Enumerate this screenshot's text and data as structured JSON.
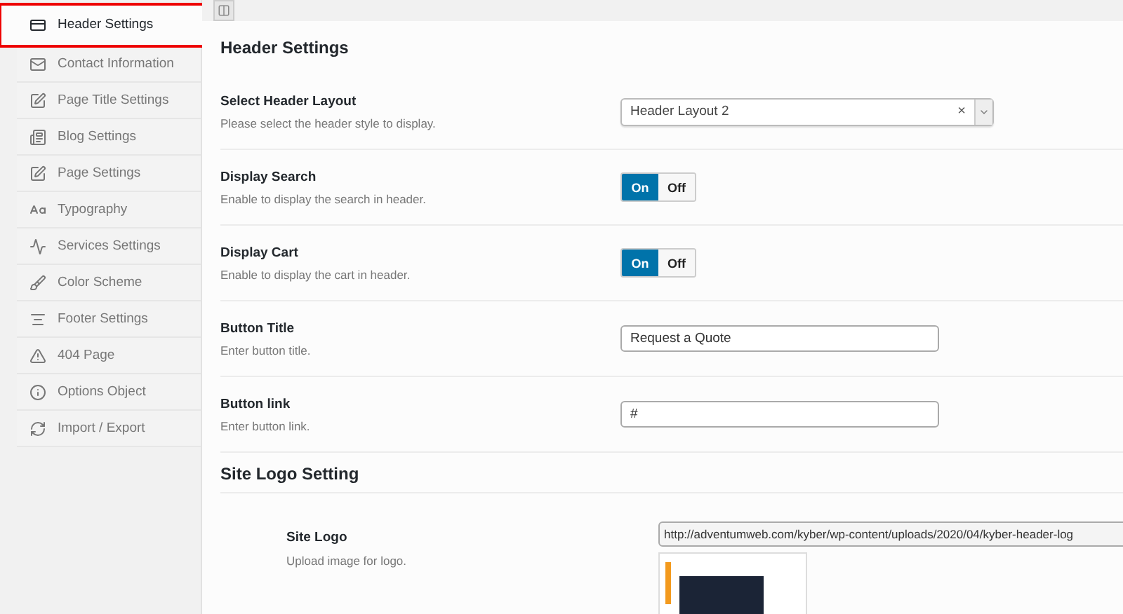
{
  "sidebar": {
    "items": [
      {
        "label": "Header Settings",
        "selected": true
      },
      {
        "label": "Contact Information",
        "selected": false
      },
      {
        "label": "Page Title Settings",
        "selected": false
      },
      {
        "label": "Blog Settings",
        "selected": false
      },
      {
        "label": "Page Settings",
        "selected": false
      },
      {
        "label": "Typography",
        "selected": false
      },
      {
        "label": "Services Settings",
        "selected": false
      },
      {
        "label": "Color Scheme",
        "selected": false
      },
      {
        "label": "Footer Settings",
        "selected": false
      },
      {
        "label": "404 Page",
        "selected": false
      },
      {
        "label": "Options Object",
        "selected": false
      },
      {
        "label": "Import / Export",
        "selected": false
      }
    ]
  },
  "section_title": "Header Settings",
  "fields": [
    {
      "kind": "select",
      "title": "Select Header Layout",
      "description": "Please select the header style to display.",
      "value": "Header Layout 2",
      "clear": "×"
    },
    {
      "kind": "toggle",
      "title": "Display Search",
      "description": "Enable to display the search in header.",
      "on_label": "On",
      "off_label": "Off",
      "on": true
    },
    {
      "kind": "toggle",
      "title": "Display Cart",
      "description": "Enable to display the cart in header.",
      "on_label": "On",
      "off_label": "Off",
      "on": true
    },
    {
      "kind": "text",
      "title": "Button Title",
      "description": "Enter button title.",
      "value": "Request a Quote"
    },
    {
      "kind": "text",
      "title": "Button link",
      "description": "Enter button link.",
      "value": "#"
    }
  ],
  "logo_section": {
    "title": "Site Logo Setting",
    "label": "Site Logo",
    "description": "Upload image for logo.",
    "url": "http://adventumweb.com/kyber/wp-content/uploads/2020/04/kyber-header-log"
  }
}
